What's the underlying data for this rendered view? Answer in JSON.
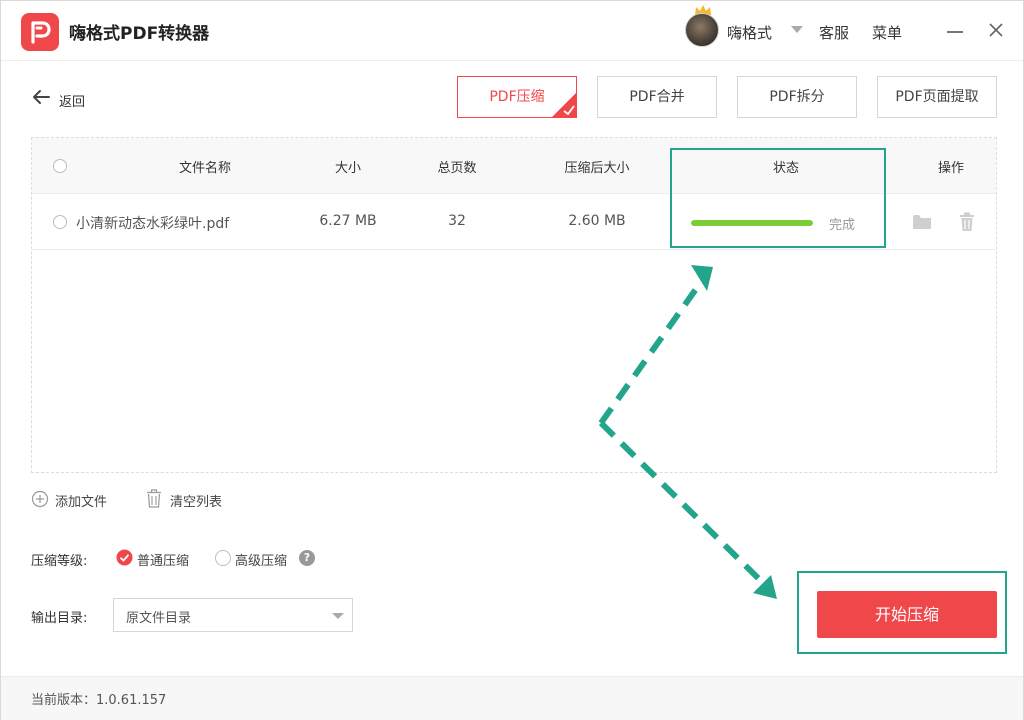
{
  "app": {
    "title": "嗨格式PDF转换器"
  },
  "header": {
    "username": "嗨格式",
    "service_label": "客服",
    "menu_label": "菜单"
  },
  "toolbar": {
    "back_label": "返回",
    "tabs": [
      {
        "label": "PDF压缩",
        "active": true
      },
      {
        "label": "PDF合并",
        "active": false
      },
      {
        "label": "PDF拆分",
        "active": false
      },
      {
        "label": "PDF页面提取",
        "active": false
      }
    ]
  },
  "table": {
    "columns": [
      "文件名称",
      "大小",
      "总页数",
      "压缩后大小",
      "状态",
      "操作"
    ],
    "rows": [
      {
        "name": "小清新动态水彩绿叶.pdf",
        "size": "6.27 MB",
        "pages": "32",
        "compressed_size": "2.60 MB",
        "status": "完成",
        "progress": 1.0
      }
    ]
  },
  "actions": {
    "add_file": "添加文件",
    "clear_list": "清空列表"
  },
  "settings": {
    "level_label": "压缩等级:",
    "options": [
      {
        "label": "普通压缩",
        "selected": true
      },
      {
        "label": "高级压缩",
        "selected": false
      }
    ],
    "output_label": "输出目录:",
    "output_value": "原文件目录"
  },
  "start_button": "开始压缩",
  "footer": {
    "version": "当前版本：1.0.61.157"
  },
  "colors": {
    "accent": "#f0474b",
    "progress": "#7ccc34",
    "highlight": "#22a58a"
  },
  "icons": [
    "app-logo-icon",
    "crown-icon",
    "caret-down-icon",
    "minimize-icon",
    "close-icon",
    "back-arrow-icon",
    "checkmark-icon",
    "folder-icon",
    "trash-icon",
    "plus-circle-icon",
    "help-icon"
  ]
}
